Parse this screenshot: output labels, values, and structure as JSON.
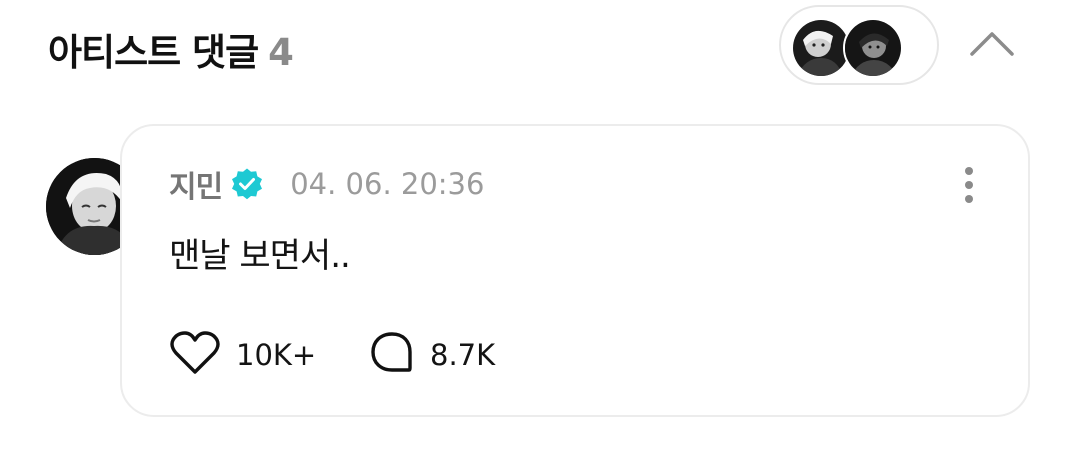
{
  "header": {
    "title": "아티스트 댓글",
    "count": "4"
  },
  "avatars": [
    "person-a-avatar",
    "person-b-avatar"
  ],
  "comment": {
    "author": "지민",
    "verified": true,
    "timestamp": "04. 06. 20:36",
    "text": "맨날 보면서..",
    "likes": "10K+",
    "replies": "8.7K"
  },
  "icons": {
    "verified": "verified-badge-icon",
    "like": "heart-icon",
    "reply": "speech-bubble-icon",
    "more": "more-vertical-icon",
    "collapse": "chevron-up-icon"
  },
  "colors": {
    "verified": "#1ec9d3",
    "title": "#111111",
    "count": "#8a8a8a",
    "meta": "#9b9b9b"
  }
}
